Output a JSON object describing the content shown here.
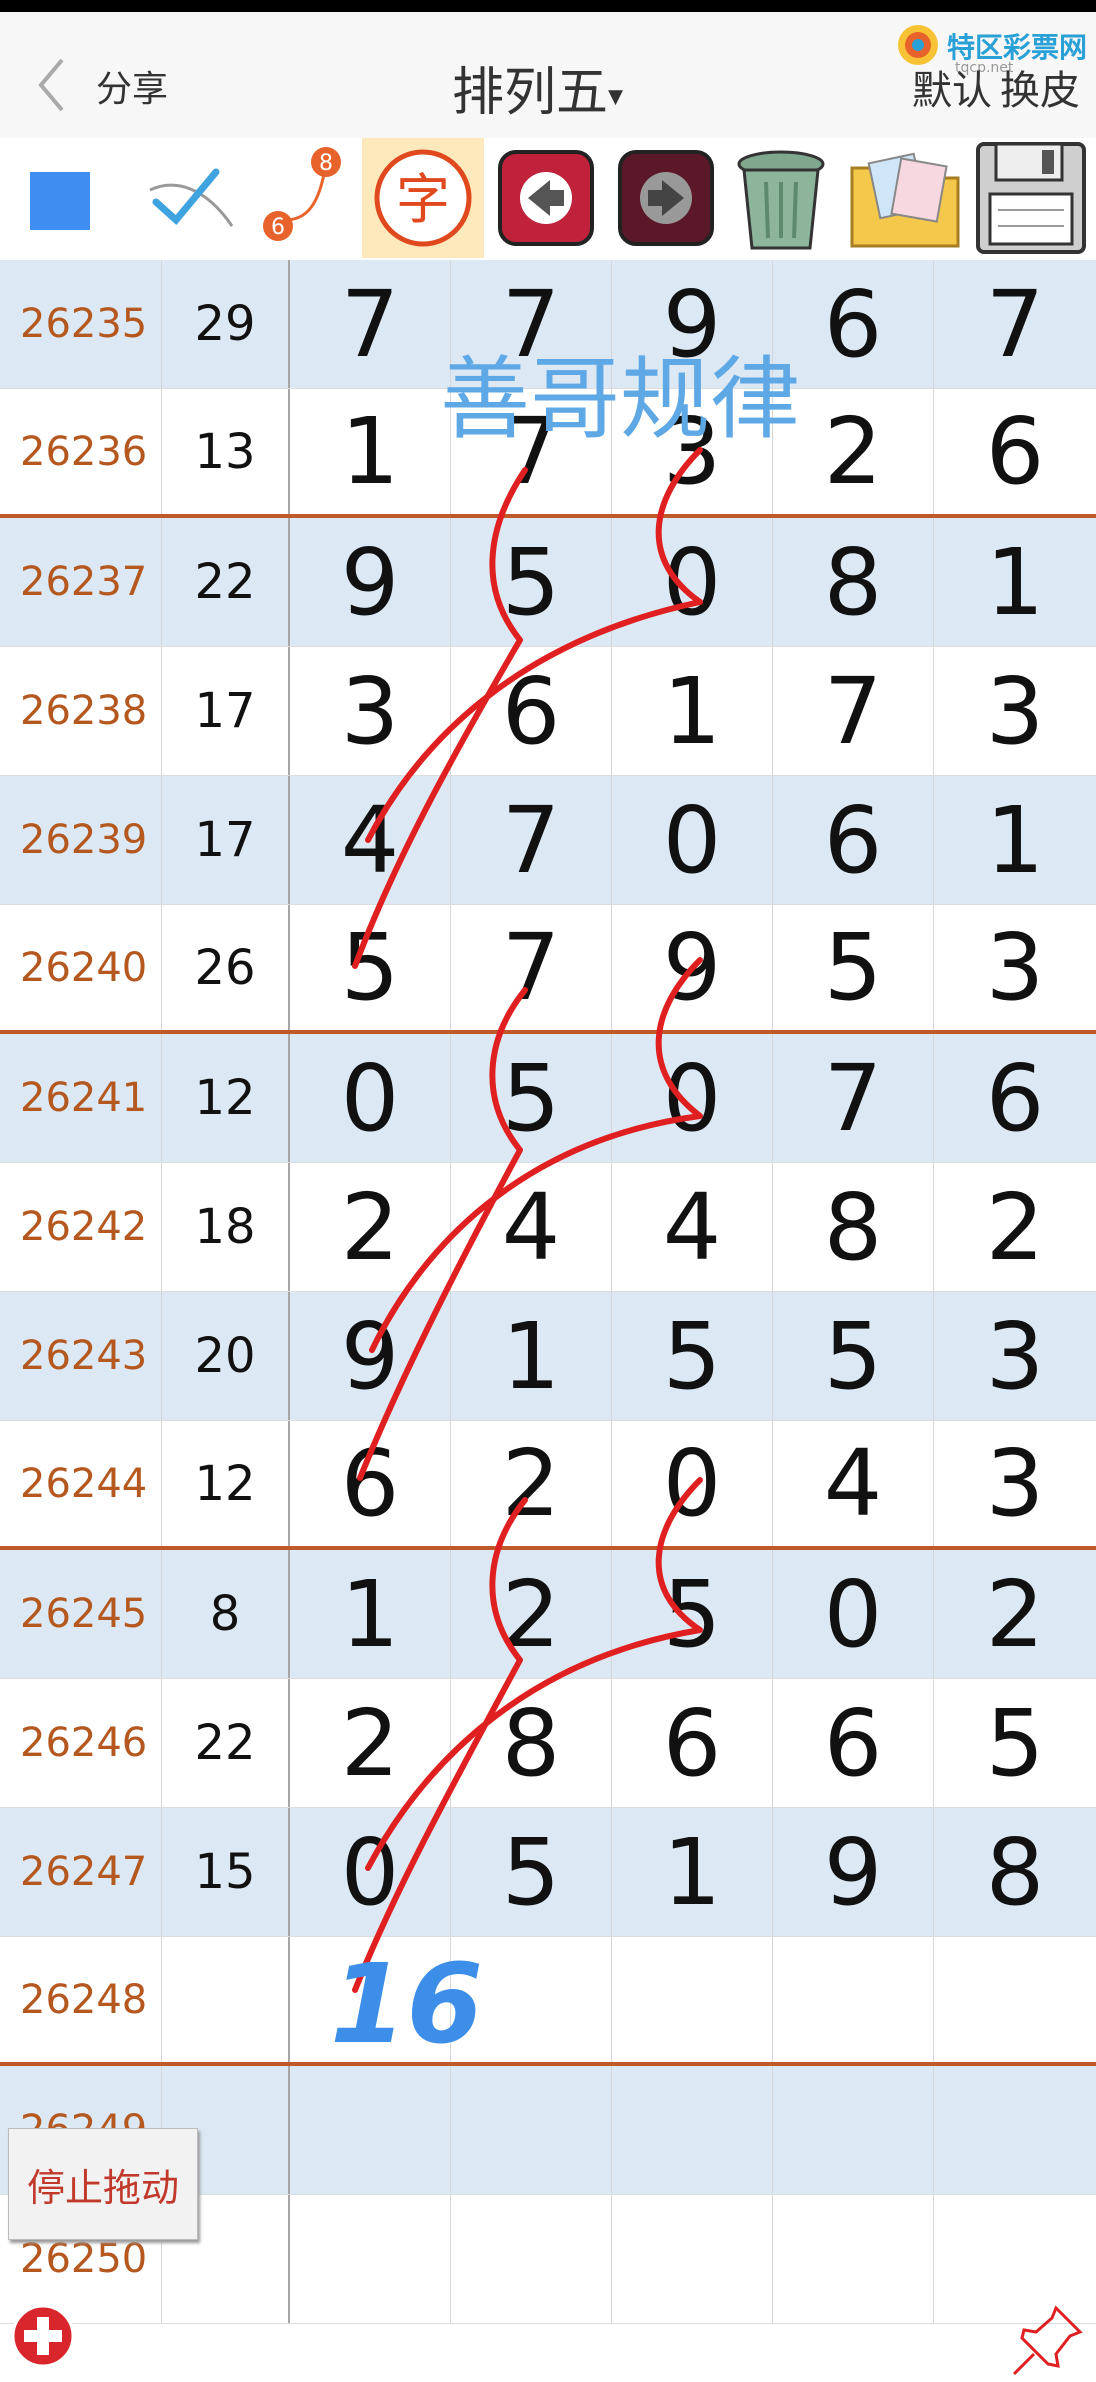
{
  "header": {
    "share": "分享",
    "title": "排列五",
    "title_arrow": "▾",
    "logo_text": "特区彩票网",
    "logo_url": "tqcp.net",
    "default_label": "默认",
    "skin_label": "换皮"
  },
  "toolbar": {
    "icons": [
      "square-color-icon",
      "brush-check-icon",
      "line-6-8-icon",
      "zi-text-icon",
      "undo-arrow-icon",
      "redo-arrow-icon",
      "trash-icon",
      "photo-folder-icon",
      "save-floppy-icon"
    ],
    "zi_char": "字",
    "num_8": "8",
    "num_6": "6"
  },
  "overlay": {
    "title": "善哥规律",
    "handwritten_number": "16"
  },
  "table": {
    "rows": [
      {
        "id": "26235",
        "sum": "29",
        "d": [
          "7",
          "7",
          "9",
          "6",
          "7"
        ]
      },
      {
        "id": "26236",
        "sum": "13",
        "d": [
          "1",
          "7",
          "3",
          "2",
          "6"
        ]
      },
      {
        "id": "26237",
        "sum": "22",
        "d": [
          "9",
          "5",
          "0",
          "8",
          "1"
        ]
      },
      {
        "id": "26238",
        "sum": "17",
        "d": [
          "3",
          "6",
          "1",
          "7",
          "3"
        ]
      },
      {
        "id": "26239",
        "sum": "17",
        "d": [
          "4",
          "7",
          "0",
          "6",
          "1"
        ]
      },
      {
        "id": "26240",
        "sum": "26",
        "d": [
          "5",
          "7",
          "9",
          "5",
          "3"
        ]
      },
      {
        "id": "26241",
        "sum": "12",
        "d": [
          "0",
          "5",
          "0",
          "7",
          "6"
        ]
      },
      {
        "id": "26242",
        "sum": "18",
        "d": [
          "2",
          "4",
          "4",
          "8",
          "2"
        ]
      },
      {
        "id": "26243",
        "sum": "20",
        "d": [
          "9",
          "1",
          "5",
          "5",
          "3"
        ]
      },
      {
        "id": "26244",
        "sum": "12",
        "d": [
          "6",
          "2",
          "0",
          "4",
          "3"
        ]
      },
      {
        "id": "26245",
        "sum": "8",
        "d": [
          "1",
          "2",
          "5",
          "0",
          "2"
        ]
      },
      {
        "id": "26246",
        "sum": "22",
        "d": [
          "2",
          "8",
          "6",
          "6",
          "5"
        ]
      },
      {
        "id": "26247",
        "sum": "15",
        "d": [
          "0",
          "5",
          "1",
          "9",
          "8"
        ]
      },
      {
        "id": "26248",
        "sum": "",
        "d": [
          "",
          "",
          "",
          "",
          ""
        ]
      },
      {
        "id": "26249",
        "sum": "",
        "d": [
          "",
          "",
          "",
          "",
          ""
        ]
      },
      {
        "id": "26250",
        "sum": "",
        "d": [
          "",
          "",
          "",
          "",
          ""
        ]
      }
    ]
  },
  "floating": {
    "stop_drag": "停止拖动"
  },
  "colors": {
    "row_alt": "#dce9f5",
    "id_text": "#b5581f",
    "group_line": "#c0592a",
    "red_ink": "#e02020",
    "blue_ink": "#3c8ee8"
  }
}
